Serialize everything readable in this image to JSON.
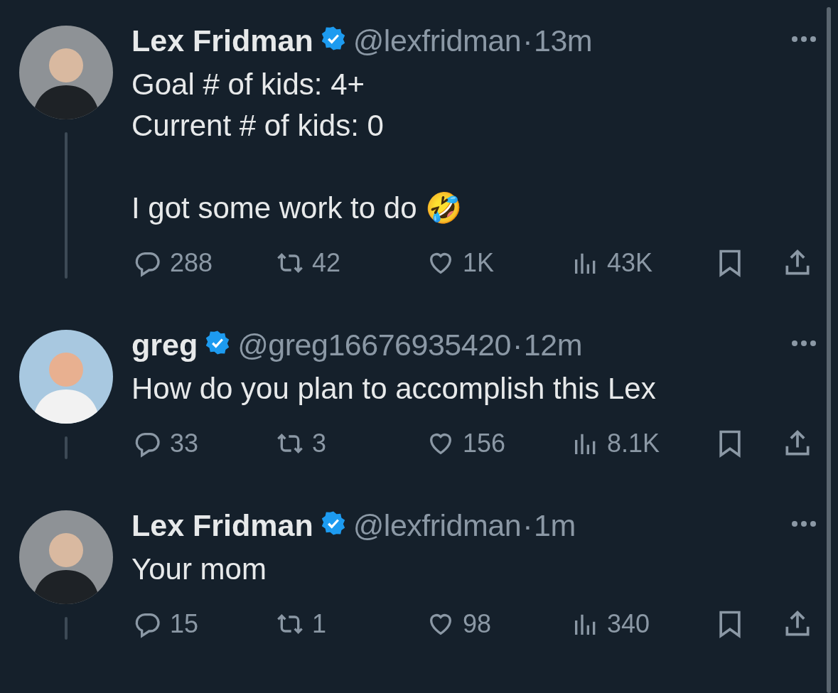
{
  "tweets": [
    {
      "name": "Lex Fridman",
      "verified": true,
      "handle": "@lexfridman",
      "dot": "·",
      "time": "13m",
      "avatar": {
        "kind": "picture",
        "color": "#8e9296"
      },
      "paragraphs": [
        "Goal # of kids: 4+\nCurrent # of kids: 0",
        "I got some work to do 🤣"
      ],
      "replies": "288",
      "reposts": "42",
      "likes": "1K",
      "views": "43K",
      "thread_line": true
    },
    {
      "name": "greg",
      "verified": true,
      "handle": "@greg16676935420",
      "dot": "·",
      "time": "12m",
      "avatar": {
        "kind": "picture",
        "color": "#a8c8e0"
      },
      "paragraphs": [
        "How do you plan to accomplish this Lex"
      ],
      "replies": "33",
      "reposts": "3",
      "likes": "156",
      "views": "8.1K",
      "thread_line": true
    },
    {
      "name": "Lex Fridman",
      "verified": true,
      "handle": "@lexfridman",
      "dot": "·",
      "time": "1m",
      "avatar": {
        "kind": "picture",
        "color": "#8e9296"
      },
      "paragraphs": [
        "Your mom"
      ],
      "replies": "15",
      "reposts": "1",
      "likes": "98",
      "views": "340",
      "thread_line": true
    }
  ]
}
